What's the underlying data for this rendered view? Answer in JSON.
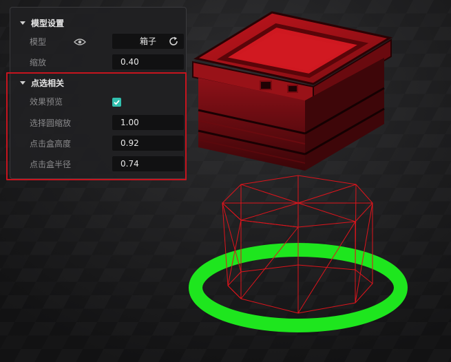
{
  "panel": {
    "section_model": {
      "title": "模型设置",
      "model_label": "模型",
      "model_value": "箱子",
      "scale_label": "缩放",
      "scale_value": "0.40"
    },
    "section_pick": {
      "title": "点选相关",
      "preview_label": "效果预览",
      "preview_checked": true,
      "circle_scale_label": "选择圆缩放",
      "circle_scale_value": "1.00",
      "box_height_label": "点击盒高度",
      "box_height_value": "0.92",
      "box_radius_label": "点击盒半径",
      "box_radius_value": "0.74"
    }
  },
  "colors": {
    "accent_check": "#31bfae",
    "highlight": "#c8141e",
    "selection_ring": "#1ee61e",
    "wireframe": "#e0141c",
    "chest": "#a8121a"
  },
  "icons": {
    "eye": "eye-icon",
    "refresh": "refresh-icon",
    "check": "check-icon",
    "collapse": "caret-down-icon"
  }
}
